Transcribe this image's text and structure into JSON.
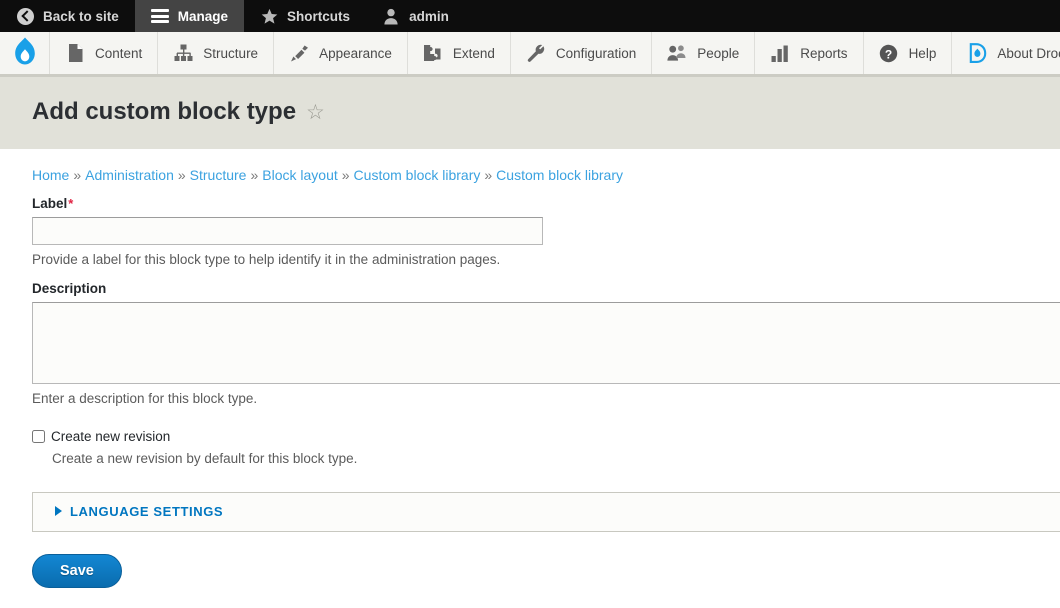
{
  "admin_bar": {
    "items": [
      {
        "label": "Back to site",
        "icon": "back-arrow-icon",
        "active": false
      },
      {
        "label": "Manage",
        "icon": "hamburger-icon",
        "active": true
      },
      {
        "label": "Shortcuts",
        "icon": "star-icon",
        "active": false
      },
      {
        "label": "admin",
        "icon": "user-icon",
        "active": false
      }
    ]
  },
  "toolbar": {
    "logo": "drupal-droplet-logo",
    "items": [
      {
        "label": "Content",
        "icon": "page-icon"
      },
      {
        "label": "Structure",
        "icon": "sitemap-icon"
      },
      {
        "label": "Appearance",
        "icon": "paintbrush-icon"
      },
      {
        "label": "Extend",
        "icon": "puzzle-piece-icon"
      },
      {
        "label": "Configuration",
        "icon": "wrench-icon"
      },
      {
        "label": "People",
        "icon": "people-icon"
      },
      {
        "label": "Reports",
        "icon": "bar-chart-icon"
      },
      {
        "label": "Help",
        "icon": "question-mark-icon"
      },
      {
        "label": "About Droopler",
        "icon": "droopler-droplet-icon"
      }
    ]
  },
  "page": {
    "title": "Add custom block type",
    "star_glyph": "☆"
  },
  "breadcrumb": {
    "separator": "»",
    "items": [
      {
        "label": "Home"
      },
      {
        "label": "Administration"
      },
      {
        "label": "Structure"
      },
      {
        "label": "Block layout"
      },
      {
        "label": "Custom block library"
      },
      {
        "label": "Custom block library"
      }
    ]
  },
  "form": {
    "label_field": {
      "label": "Label",
      "required_mark": "*",
      "value": "",
      "placeholder": "",
      "description": "Provide a label for this block type to help identify it in the administration pages."
    },
    "description_field": {
      "label": "Description",
      "value": "",
      "placeholder": "",
      "description": "Enter a description for this block type."
    },
    "revision_checkbox": {
      "label": "Create new revision",
      "checked": false,
      "description": "Create a new revision by default for this block type."
    },
    "language_settings": {
      "summary": "LANGUAGE SETTINGS",
      "expanded": false
    },
    "save_button": "Save"
  },
  "colors": {
    "admin_bar_bg": "#0d0d0d",
    "admin_bar_active": "#444444",
    "toolbar_bg": "#f5f5f2",
    "title_band_bg": "#e1e1d9",
    "link_blue": "#3ba2e0",
    "accent_blue": "#0076c0",
    "button_blue": "#0d77bf",
    "required_red": "#e02443"
  }
}
